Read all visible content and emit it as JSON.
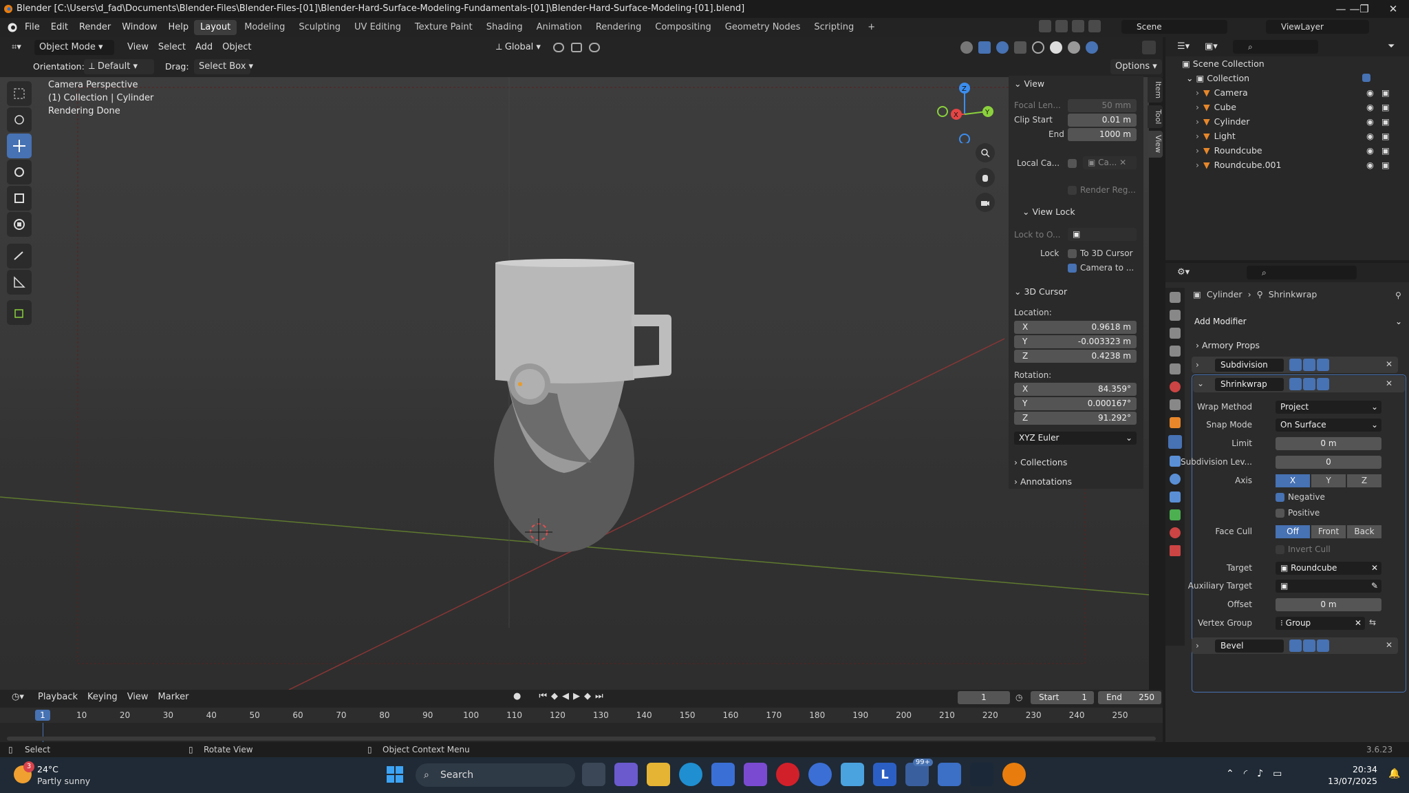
{
  "window": {
    "title": "Blender [C:\\Users\\d_fad\\Documents\\Blender-Files\\Blender-Files-[01]\\Blender-Hard-Surface-Modeling-Fundamentals-[01]\\Blender-Hard-Surface-Modeling-[01].blend]"
  },
  "menu": [
    "File",
    "Edit",
    "Render",
    "Window",
    "Help"
  ],
  "workspaces": [
    "Layout",
    "Modeling",
    "Sculpting",
    "UV Editing",
    "Texture Paint",
    "Shading",
    "Animation",
    "Rendering",
    "Compositing",
    "Geometry Nodes",
    "Scripting"
  ],
  "workspace_add": "+",
  "scene": "Scene",
  "view_layer": "ViewLayer",
  "viewport_header": {
    "mode": "Object Mode",
    "menus": [
      "View",
      "Select",
      "Add",
      "Object"
    ],
    "transform": "Global"
  },
  "tool_header": {
    "orientation_label": "Orientation:",
    "orientation": "Default",
    "drag_label": "Drag:",
    "drag": "Select Box",
    "options": "Options"
  },
  "overlay_text": [
    "Camera Perspective",
    "(1) Collection | Cylinder",
    "Rendering Done"
  ],
  "gizmo": {
    "x": "X",
    "y": "Y",
    "z": "Z"
  },
  "npanel": {
    "tabs": [
      "Item",
      "Tool",
      "View"
    ],
    "view": {
      "title": "View",
      "focal_label": "Focal Len...",
      "focal": "50 mm",
      "clip_start_label": "Clip Start",
      "clip_start": "0.01 m",
      "end_label": "End",
      "end": "1000 m",
      "local_cam_label": "Local Ca...",
      "local_cam": "Ca...",
      "render_region": "Render Reg..."
    },
    "view_lock": {
      "title": "View Lock",
      "lock_to_label": "Lock to O...",
      "lock_label": "Lock",
      "to_cursor": "To 3D Cursor",
      "camera_to": "Camera to ..."
    },
    "cursor": {
      "title": "3D Cursor",
      "location_label": "Location:",
      "x": "0.9618 m",
      "y": "-0.003323 m",
      "z": "0.4238 m",
      "rotation_label": "Rotation:",
      "rx": "84.359°",
      "ry": "0.000167°",
      "rz": "91.292°",
      "mode": "XYZ Euler",
      "x_label": "X",
      "y_label": "Y",
      "z_label": "Z"
    },
    "collections": "Collections",
    "annotations": "Annotations"
  },
  "outliner": {
    "root": "Scene Collection",
    "collection": "Collection",
    "items": [
      "Camera",
      "Cube",
      "Cylinder",
      "Light",
      "Roundcube",
      "Roundcube.001"
    ]
  },
  "properties": {
    "breadcrumb_object": "Cylinder",
    "breadcrumb_modifier": "Shrinkwrap",
    "add_modifier": "Add Modifier",
    "armory": "Armory Props",
    "subdivision": "Subdivision",
    "shrinkwrap": "Shrinkwrap",
    "wrap_method_label": "Wrap Method",
    "wrap_method": "Project",
    "snap_mode_label": "Snap Mode",
    "snap_mode": "On Surface",
    "limit_label": "Limit",
    "limit": "0 m",
    "subdiv_label": "Subdivision Lev...",
    "subdiv": "0",
    "axis_label": "Axis",
    "axis": [
      "X",
      "Y",
      "Z"
    ],
    "negative": "Negative",
    "positive": "Positive",
    "face_cull_label": "Face Cull",
    "face_cull": [
      "Off",
      "Front",
      "Back"
    ],
    "invert_cull": "Invert Cull",
    "target_label": "Target",
    "target": "Roundcube",
    "aux_label": "Auxiliary Target",
    "offset_label": "Offset",
    "offset": "0 m",
    "vgroup_label": "Vertex Group",
    "vgroup": "Group",
    "bevel": "Bevel"
  },
  "timeline": {
    "menus": [
      "Playback",
      "Keying",
      "View",
      "Marker"
    ],
    "current": "1",
    "start_label": "Start",
    "start": "1",
    "end_label": "End",
    "end": "250",
    "ticks": [
      "1",
      "10",
      "20",
      "30",
      "40",
      "50",
      "60",
      "70",
      "80",
      "90",
      "100",
      "110",
      "120",
      "130",
      "140",
      "150",
      "160",
      "170",
      "180",
      "190",
      "200",
      "210",
      "220",
      "230",
      "240",
      "250"
    ]
  },
  "statusbar": {
    "select": "Select",
    "rotate": "Rotate View",
    "context": "Object Context Menu",
    "version": "3.6.23"
  },
  "taskbar": {
    "weather_temp": "24°C",
    "weather_desc": "Partly sunny",
    "weather_badge": "3",
    "search": "Search",
    "badge": "99+",
    "time": "20:34",
    "date": "13/07/2025"
  },
  "colors": {
    "accent": "#4772b3",
    "x_axis": "#e64545",
    "y_axis": "#8bd13d",
    "z_axis": "#3b8ef0"
  }
}
